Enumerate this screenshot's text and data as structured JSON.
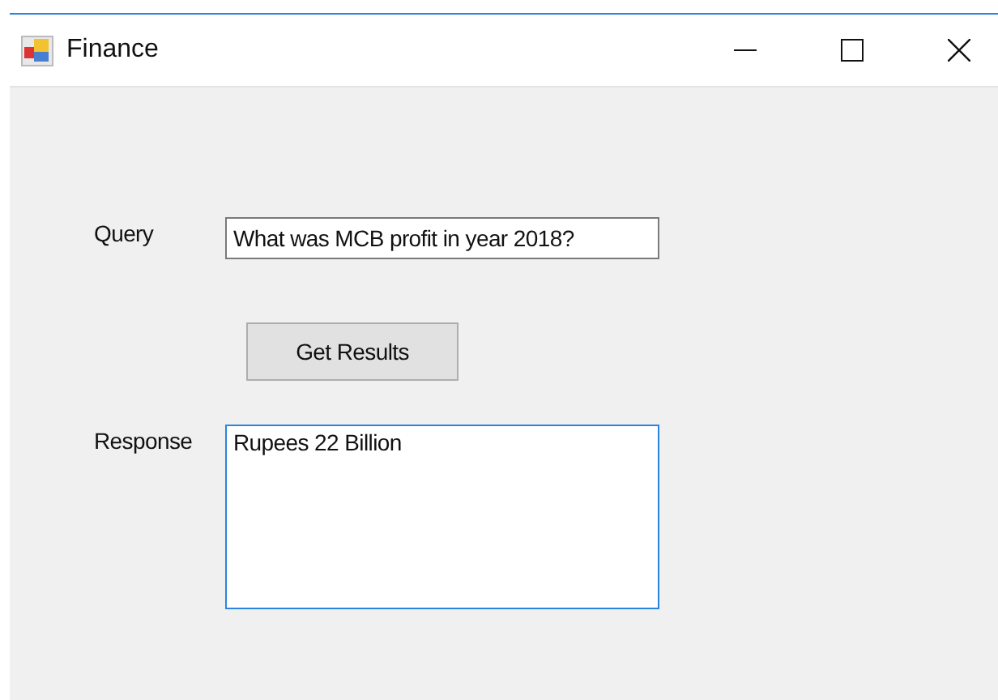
{
  "window": {
    "title": "Finance"
  },
  "form": {
    "query": {
      "label": "Query",
      "value": "What was MCB profit in year 2018?",
      "focused": false
    },
    "button": {
      "label": "Get Results"
    },
    "response": {
      "label": "Response",
      "value": "Rupees 22 Billion",
      "focused": true
    }
  }
}
